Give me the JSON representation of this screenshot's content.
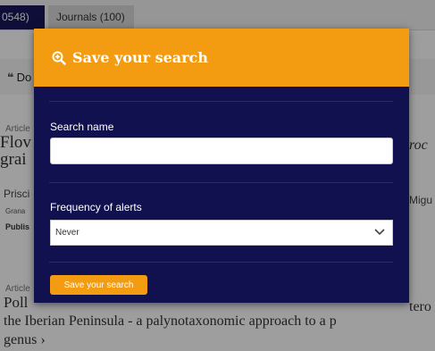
{
  "background": {
    "tabs": [
      {
        "label": "0548)"
      },
      {
        "label": "Journals (100)"
      }
    ],
    "toolbar_fragment": "Do",
    "results": [
      {
        "type": "Article",
        "title_fragment": "Flov\ngrai",
        "title_right_fragment": "roc",
        "authors_fragment": "Prisci",
        "authors_right_fragment": "Migu",
        "journal_fragment": "Grana",
        "published_fragment": "Publis"
      },
      {
        "type": "Article",
        "title_fragment": "Poll",
        "title_right_fragment": "tero",
        "line2": "the Iberian Peninsula - a palynotaxonomic approach to a p",
        "line3": "genus ›"
      }
    ]
  },
  "modal": {
    "title": "Save your search",
    "title_icon": "zoom-in-icon",
    "search_name_label": "Search name",
    "search_name_value": "",
    "frequency_label": "Frequency of alerts",
    "frequency_selected": "Never",
    "save_button_label": "Save your search"
  },
  "colors": {
    "modal_bg": "#121150",
    "accent": "#f39c12",
    "tab_active": "#17175c"
  }
}
